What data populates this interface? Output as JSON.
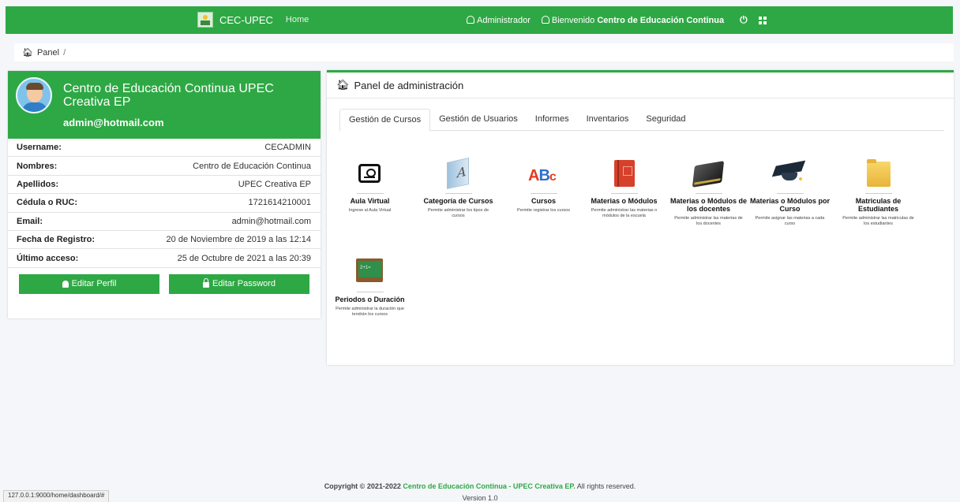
{
  "navbar": {
    "brand": "CEC-UPEC",
    "home": "Home",
    "admin_link": "Administrador",
    "welcome_prefix": "Bienvenido",
    "welcome_name": "Centro de Educación Continua"
  },
  "breadcrumb": {
    "root": "Panel",
    "separator": "/"
  },
  "profile": {
    "name": "Centro de Educación Continua UPEC Creativa EP",
    "email": "admin@hotmail.com",
    "fields": [
      {
        "label": "Username:",
        "value": "CECADMIN"
      },
      {
        "label": "Nombres:",
        "value": "Centro de Educación Continua"
      },
      {
        "label": "Apellidos:",
        "value": "UPEC Creativa EP"
      },
      {
        "label": "Cédula o RUC:",
        "value": "1721614210001"
      },
      {
        "label": "Email:",
        "value": "admin@hotmail.com"
      },
      {
        "label": "Fecha de Registro:",
        "value": "20 de Noviembre de 2019 a las 12:14"
      },
      {
        "label": "Último acceso:",
        "value": "25 de Octubre de 2021 a las 20:39"
      }
    ],
    "edit_profile": "Editar Perfil",
    "edit_password": "Editar Password"
  },
  "admin": {
    "title": "Panel de administración",
    "tabs": [
      "Gestión de Cursos",
      "Gestión de Usuarios",
      "Informes",
      "Inventarios",
      "Seguridad"
    ],
    "modules": [
      {
        "title": "Aula Virtual",
        "desc": "Ingrese al Aula Virtual",
        "icon": "virtual-classroom-icon"
      },
      {
        "title": "Categoría de Cursos",
        "desc": "Permite administrar los tipos de cursos",
        "icon": "category-icon"
      },
      {
        "title": "Cursos",
        "desc": "Permite registrar los cursos",
        "icon": "abc-icon"
      },
      {
        "title": "Materias o Módulos",
        "desc": "Permite administrar las materias o módulos de la escuela",
        "icon": "notebook-icon"
      },
      {
        "title": "Materias o Módulos de los docentes",
        "desc": "Permite administrar las materias de los docentes",
        "icon": "book-icon"
      },
      {
        "title": "Materias o Módulos por Curso",
        "desc": "Permite asignar las materias a cada curso",
        "icon": "graduation-cap-icon"
      },
      {
        "title": "Matriculas de Estudiantes",
        "desc": "Permite administrar las matriculas de los estudiantes",
        "icon": "folder-icon"
      },
      {
        "title": "Periodos o Duración",
        "desc": "Permite administrar la duración que tendrán los cursos",
        "icon": "chalkboard-icon"
      }
    ],
    "abc": {
      "a": "A",
      "b": "B",
      "c": "c"
    }
  },
  "footer": {
    "copyright": "Copyright © 2021-2022",
    "org": "Centro de Educación Continua - UPEC Creativa EP.",
    "rights": "All rights reserved.",
    "version": "Version 1.0"
  },
  "status_url": "127.0.0.1:9000/home/dashboard/#",
  "colors": {
    "accent": "#2ea844"
  }
}
